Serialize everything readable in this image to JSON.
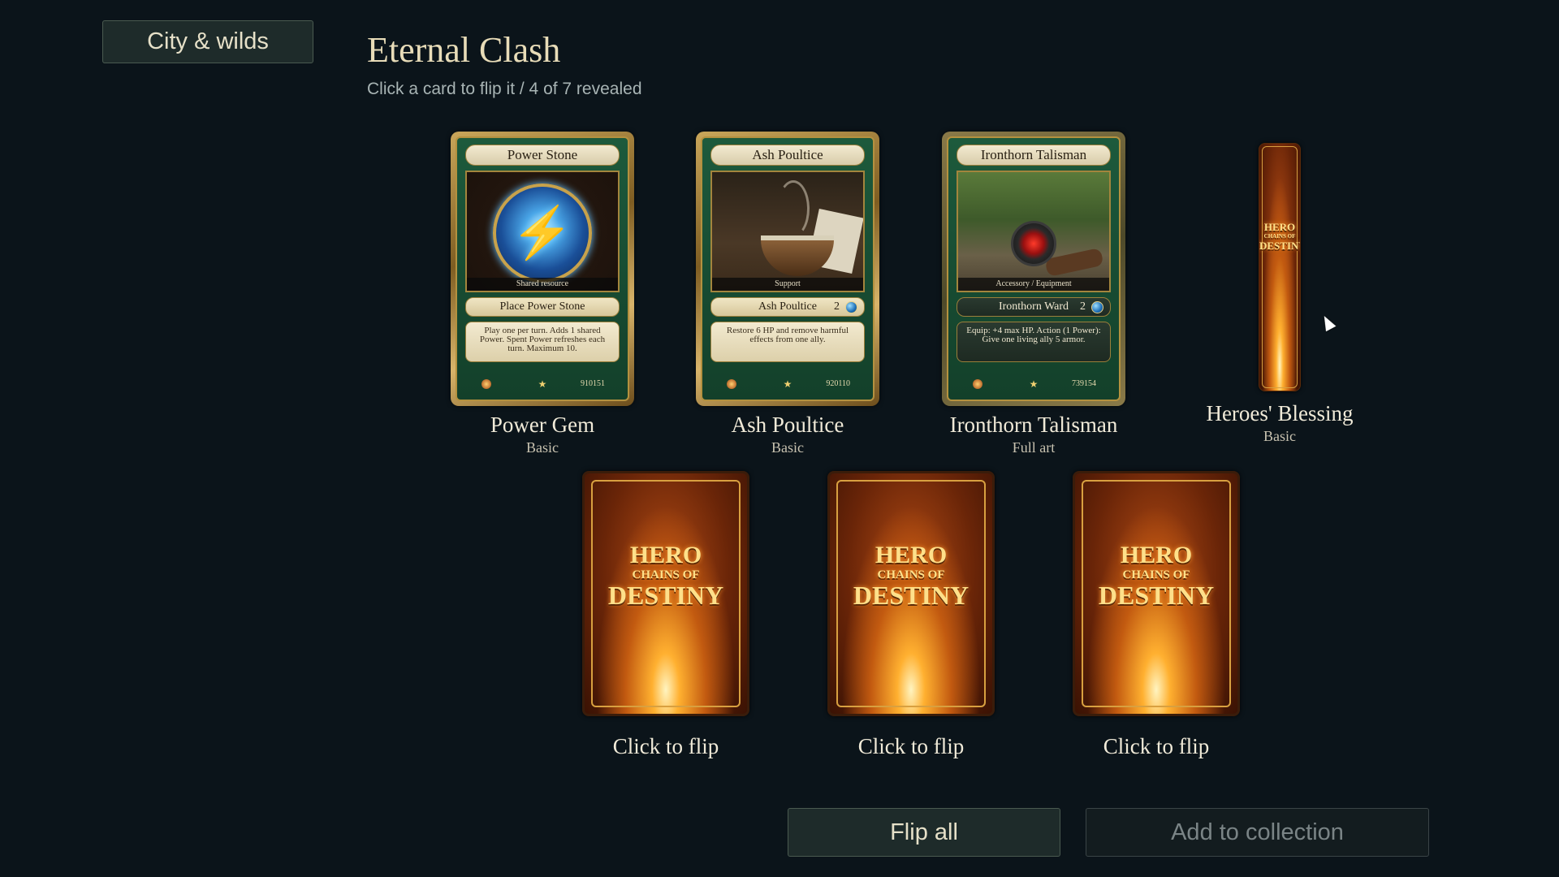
{
  "nav": {
    "label": "City & wilds"
  },
  "header": {
    "title": "Eternal Clash",
    "subtitle": "Click a card to flip it / 4 of 7 revealed"
  },
  "revealed": [
    {
      "name": "Power Gem",
      "rarity": "Basic",
      "card": {
        "title": "Power Stone",
        "art_caption": "Shared resource",
        "ability": "Place Power Stone",
        "cost": "",
        "text": "Play one per turn. Adds 1 shared Power. Spent Power refreshes each turn. Maximum 10.",
        "number": "910151",
        "art": "lightning-orb-icon"
      }
    },
    {
      "name": "Ash Poultice",
      "rarity": "Basic",
      "card": {
        "title": "Ash Poultice",
        "art_caption": "Support",
        "ability": "Ash Poultice",
        "cost": "2",
        "text": "Restore 6 HP and remove harmful effects from one ally.",
        "number": "920110",
        "art": "herbal-bowl-icon"
      }
    },
    {
      "name": "Ironthorn Talisman",
      "rarity": "Full art",
      "card": {
        "title": "Ironthorn Talisman",
        "art_caption": "Accessory / Equipment",
        "ability": "Ironthorn Ward",
        "cost": "2",
        "text": "Equip: +4 max HP. Action (1 Power): Give one living ally 5 armor.",
        "number": "739154",
        "art": "ruby-amulet-icon"
      }
    },
    {
      "name": "Heroes' Blessing",
      "rarity": "Basic",
      "card": null
    }
  ],
  "card_back": {
    "line1": "HERO",
    "line2": "CHAINS OF",
    "line3": "DESTINY"
  },
  "hidden": [
    {
      "label": "Click to flip"
    },
    {
      "label": "Click to flip"
    },
    {
      "label": "Click to flip"
    }
  ],
  "actions": {
    "flip_all": "Flip all",
    "add_to_collection": "Add to collection"
  }
}
